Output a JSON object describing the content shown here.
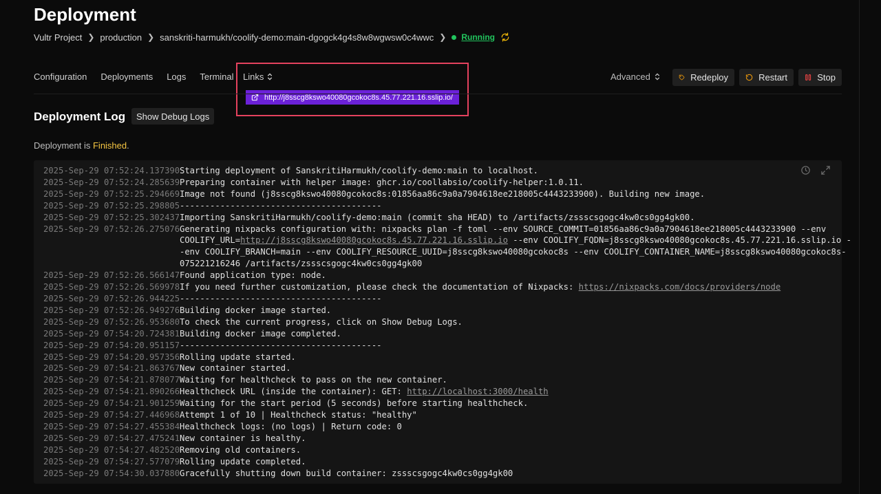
{
  "header": {
    "title": "Deployment",
    "breadcrumb": [
      "Vultr Project",
      "production",
      "sanskriti-harmukh/coolify-demo:main-dgogck4g4s8w8wgwsw0c4wwc"
    ],
    "status": "Running"
  },
  "tabs": [
    "Configuration",
    "Deployments",
    "Logs",
    "Terminal"
  ],
  "links_tab": "Links",
  "link_url": "http://j8sscg8kswo40080gcokoc8s.45.77.221.16.sslip.io/",
  "advanced_label": "Advanced",
  "actions": {
    "redeploy": "Redeploy",
    "restart": "Restart",
    "stop": "Stop"
  },
  "section": {
    "title": "Deployment Log",
    "debug_button": "Show Debug Logs",
    "status_prefix": "Deployment is ",
    "status_value": "Finished",
    "status_suffix": "."
  },
  "colors": {
    "accent": "#6b21d8",
    "highlight": "#e5425e",
    "running": "#22c55e",
    "finished": "#f5c542",
    "stop_icon": "#ef4444"
  },
  "log": [
    {
      "ts": "2025-Sep-29 07:52:24.137390",
      "msg": "Starting deployment of SanskritiHarmukh/coolify-demo:main to localhost."
    },
    {
      "ts": "2025-Sep-29 07:52:24.285639",
      "msg": "Preparing container with helper image: ghcr.io/coollabsio/coolify-helper:1.0.11."
    },
    {
      "ts": "2025-Sep-29 07:52:25.294669",
      "msg": "Image not found (j8sscg8kswo40080gcokoc8s:01856aa86c9a0a7904618ee218005c4443233900). Building new image."
    },
    {
      "ts": "2025-Sep-29 07:52:25.298805",
      "msg": "----------------------------------------"
    },
    {
      "ts": "2025-Sep-29 07:52:25.302437",
      "msg": "Importing SanskritiHarmukh/coolify-demo:main (commit sha HEAD) to /artifacts/zssscsgogc4kw0cs0gg4gk00."
    },
    {
      "ts": "2025-Sep-29 07:52:26.275076",
      "msg": "Generating nixpacks configuration with: nixpacks plan -f toml --env SOURCE_COMMIT=01856aa86c9a0a7904618ee218005c4443233900 --env",
      "cont": [
        {
          "pre": "COOLIFY_URL=",
          "link": "http://j8sscg8kswo40080gcokoc8s.45.77.221.16.sslip.io",
          "post": " --env COOLIFY_FQDN=j8sscg8kswo40080gcokoc8s.45.77.221.16.sslip.io -"
        },
        {
          "pre": "-env COOLIFY_BRANCH=main --env COOLIFY_RESOURCE_UUID=j8sscg8kswo40080gcokoc8s --env COOLIFY_CONTAINER_NAME=j8sscg8kswo40080gcokoc8s-"
        },
        {
          "pre": "075221216246 /artifacts/zssscsgogc4kw0cs0gg4gk00"
        }
      ]
    },
    {
      "ts": "2025-Sep-29 07:52:26.566147",
      "msg": "Found application type: node."
    },
    {
      "ts": "2025-Sep-29 07:52:26.569978",
      "msg": "If you need further customization, please check the documentation of Nixpacks: ",
      "link": "https://nixpacks.com/docs/providers/node"
    },
    {
      "ts": "2025-Sep-29 07:52:26.944225",
      "msg": "----------------------------------------"
    },
    {
      "ts": "2025-Sep-29 07:52:26.949276",
      "msg": "Building docker image started."
    },
    {
      "ts": "2025-Sep-29 07:52:26.953680",
      "msg": "To check the current progress, click on Show Debug Logs."
    },
    {
      "ts": "2025-Sep-29 07:54:20.724381",
      "msg": "Building docker image completed."
    },
    {
      "ts": "2025-Sep-29 07:54:20.951157",
      "msg": "----------------------------------------"
    },
    {
      "ts": "2025-Sep-29 07:54:20.957356",
      "msg": "Rolling update started."
    },
    {
      "ts": "2025-Sep-29 07:54:21.863767",
      "msg": "New container started."
    },
    {
      "ts": "2025-Sep-29 07:54:21.878077",
      "msg": "Waiting for healthcheck to pass on the new container."
    },
    {
      "ts": "2025-Sep-29 07:54:21.890266",
      "msg": "Healthcheck URL (inside the container): GET: ",
      "link": "http://localhost:3000/health"
    },
    {
      "ts": "2025-Sep-29 07:54:21.901259",
      "msg": "Waiting for the start period (5 seconds) before starting healthcheck."
    },
    {
      "ts": "2025-Sep-29 07:54:27.446968",
      "msg": "Attempt 1 of 10 | Healthcheck status: \"healthy\""
    },
    {
      "ts": "2025-Sep-29 07:54:27.455384",
      "msg": "Healthcheck logs: (no logs) | Return code: 0"
    },
    {
      "ts": "2025-Sep-29 07:54:27.475241",
      "msg": "New container is healthy."
    },
    {
      "ts": "2025-Sep-29 07:54:27.482520",
      "msg": "Removing old containers."
    },
    {
      "ts": "2025-Sep-29 07:54:27.577079",
      "msg": "Rolling update completed."
    },
    {
      "ts": "2025-Sep-29 07:54:30.037880",
      "msg": "Gracefully shutting down build container: zssscsgogc4kw0cs0gg4gk00"
    }
  ]
}
